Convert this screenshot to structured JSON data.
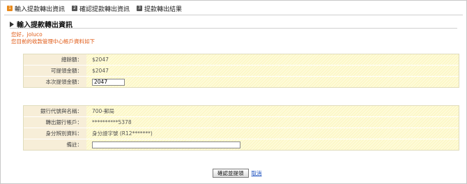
{
  "steps": [
    {
      "num": "1",
      "label": "輸入提款轉出資訊"
    },
    {
      "num": "2",
      "label": "確認提款轉出資訊"
    },
    {
      "num": "3",
      "label": "提款轉出結果"
    }
  ],
  "section_title": "輸入提款轉出資訊",
  "greeting": {
    "line1": "您好，joluco",
    "line2": "您目前的收款管理中心帳戶資料如下"
  },
  "amount_box": {
    "total_label": "總餘額：",
    "total_value": "$2047",
    "available_label": "可提領金額：",
    "available_value": "$2047",
    "withdraw_label": "本次提領金額：",
    "withdraw_value": "2047"
  },
  "bank_box": {
    "bank_label": "銀行代號與名稱：",
    "bank_value": "700-郵局",
    "account_label": "轉出銀行帳戶：",
    "account_value": "**********5378",
    "id_label": "身分辨別資料：",
    "id_value": "身分證字號 (R12*******)",
    "note_label": "備註：",
    "note_value": ""
  },
  "actions": {
    "confirm_label": "確認並提領",
    "cancel_label": "取消"
  },
  "colors": {
    "step_active": "#e98a1b",
    "greeting_text": "#e05a16",
    "label_bg": "#f7eed8",
    "value_bg": "#fefbd8",
    "link": "#1a4fbf"
  }
}
